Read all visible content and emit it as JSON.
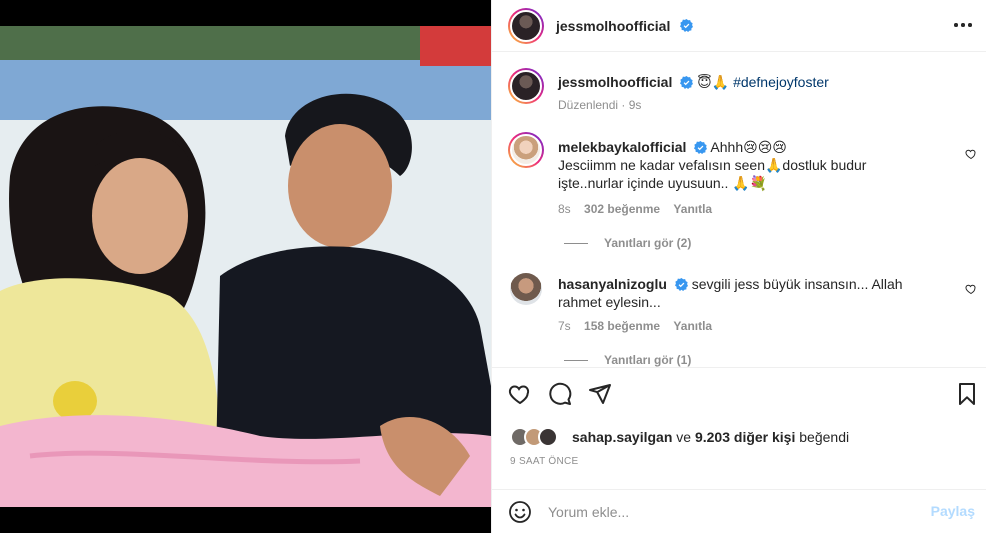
{
  "post": {
    "author": "jessmolhoofficial",
    "caption": {
      "username": "jessmolhoofficial",
      "emojis": "😇🙏",
      "hashtag": "#defnejoyfoster",
      "edited": "Düzenlendi",
      "time": "9s"
    }
  },
  "comments": [
    {
      "username": "melekbaykalofficial",
      "text_line1": "Ahhh😢😢😢",
      "text_line2": "Jesciimm ne kadar vefalısın seen🙏dostluk budur",
      "text_line3": "işte..nurlar içinde uyusuun.. 🙏💐",
      "time": "8s",
      "likes": "302 beğenme",
      "reply_label": "Yanıtla",
      "view_replies": "Yanıtları gör (2)"
    },
    {
      "username": "hasanyalnizoglu",
      "text_line1": "sevgili jess büyük insansın... Allah",
      "text_line2": "rahmet eylesin...",
      "time": "7s",
      "likes": "158 beğenme",
      "reply_label": "Yanıtla",
      "view_replies": "Yanıtları gör (1)"
    }
  ],
  "likes_summary": {
    "first_user": "sahap.sayilgan",
    "connector": "ve",
    "others": "9.203 diğer kişi",
    "suffix": "beğendi"
  },
  "time_ago": "9 SAAT ÖNCE",
  "composer": {
    "placeholder": "Yorum ekle...",
    "post_label": "Paylaş"
  },
  "icons": [
    "more-options-icon",
    "verified-badge-icon",
    "heart-icon",
    "comment-icon",
    "share-icon",
    "save-icon",
    "emoji-icon"
  ],
  "colors": {
    "verified": "#3897f0",
    "hashtag": "#00376b",
    "secondary_text": "#8e8e8e",
    "post_button_disabled": "#b3dbff"
  }
}
